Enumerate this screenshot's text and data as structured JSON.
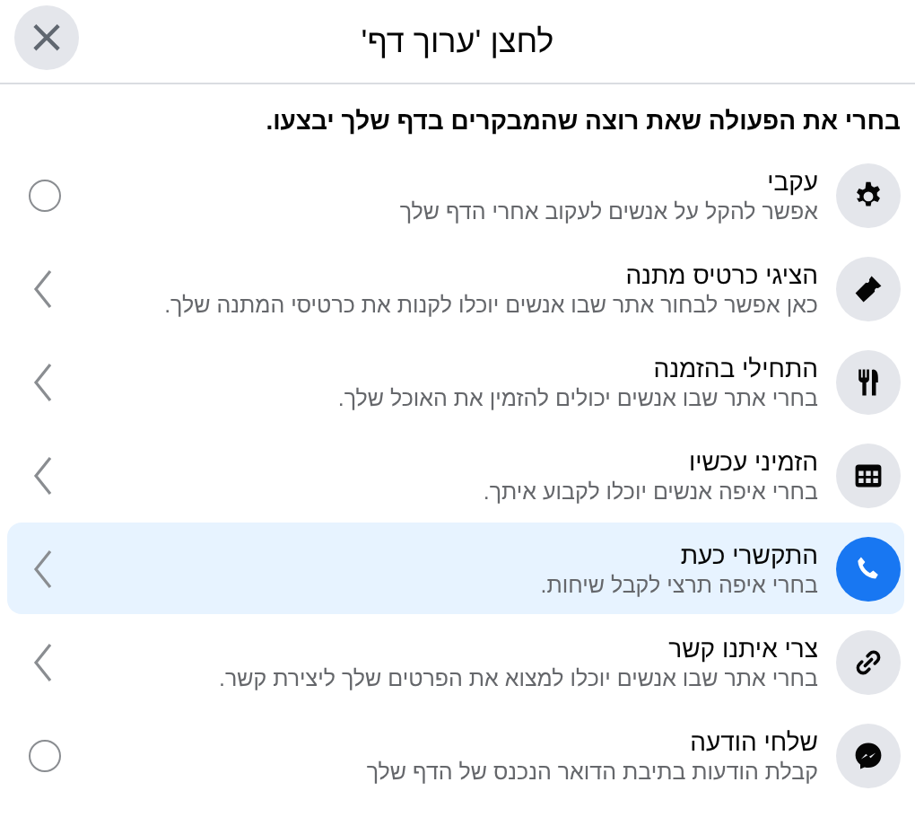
{
  "dialog": {
    "title": "לחצן 'ערוך דף'",
    "close": "×"
  },
  "prompt": "בחרי את הפעולה שאת רוצה שהמבקרים בדף שלך יבצעו.",
  "actions": [
    {
      "kind": "radio",
      "title": "עקבי",
      "description": "אפשר להקל על אנשים לעקוב אחרי הדף שלך",
      "selected": false
    },
    {
      "kind": "chevron",
      "title": "הציגי כרטיס מתנה",
      "description": "כאן אפשר לבחור אתר שבו אנשים יוכלו לקנות את כרטיסי המתנה שלך.",
      "selected": false
    },
    {
      "kind": "chevron",
      "title": "התחילי בהזמנה",
      "description": "בחרי אתר שבו אנשים יכולים להזמין את האוכל שלך.",
      "selected": false
    },
    {
      "kind": "chevron",
      "title": "הזמיני עכשיו",
      "description": "בחרי איפה אנשים יוכלו לקבוע איתך.",
      "selected": false
    },
    {
      "kind": "chevron",
      "title": "התקשרי כעת",
      "description": "בחרי איפה תרצי לקבל שיחות.",
      "selected": true
    },
    {
      "kind": "chevron",
      "title": "צרי איתנו קשר",
      "description": "בחרי אתר שבו אנשים יוכלו למצוא את הפרטים שלך ליצירת קשר.",
      "selected": false
    },
    {
      "kind": "radio",
      "title": "שלחי הודעה",
      "description": "קבלת הודעות בתיבת הדואר הנכנס של הדף שלך",
      "selected": false
    }
  ]
}
